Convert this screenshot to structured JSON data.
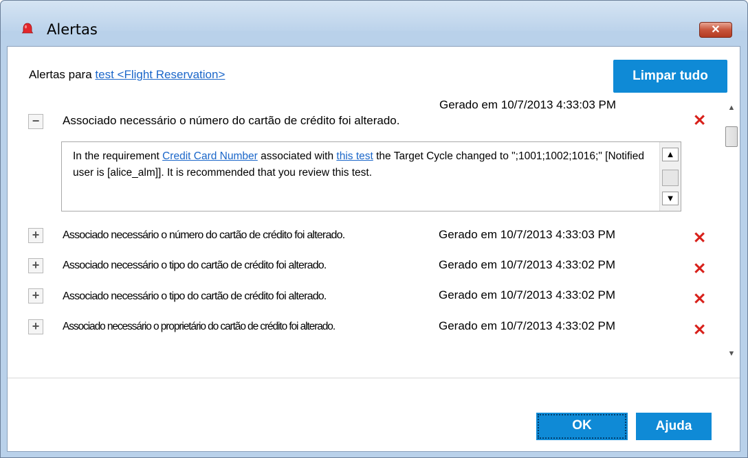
{
  "window": {
    "title": "Alertas",
    "close_label": "✕"
  },
  "header": {
    "prefix": "Alertas para",
    "entity_link": "test <Flight Reservation>",
    "clear_all": "Limpar tudo"
  },
  "alerts": [
    {
      "expanded": true,
      "toggle": "−",
      "title": "Associado necessário o número do cartão de crédito foi alterado.",
      "generated": "Gerado em 10/7/2013 4:33:03 PM",
      "detail": {
        "part1": "In the requirement ",
        "link1": "Credit Card Number",
        "part2": " associated with ",
        "link2": "this test",
        "part3": " the Target Cycle changed to \";1001;1002;1016;\" [Notified user is [alice_alm]]. It is recommended that you review this test."
      }
    },
    {
      "expanded": false,
      "toggle": "+",
      "title": "Associado necessário o número do cartão de crédito foi alterado.",
      "generated": "Gerado em 10/7/2013 4:33:03 PM"
    },
    {
      "expanded": false,
      "toggle": "+",
      "title": "Associado necessário o tipo do cartão de crédito foi alterado.",
      "generated": "Gerado em 10/7/2013 4:33:02 PM"
    },
    {
      "expanded": false,
      "toggle": "+",
      "title": "Associado necessário o tipo do cartão de crédito foi alterado.",
      "generated": "Gerado em 10/7/2013 4:33:02 PM"
    },
    {
      "expanded": false,
      "toggle": "+",
      "title": "Associado necessário o proprietário do cartão de crédito foi alterado.",
      "generated": "Gerado em 10/7/2013 4:33:02 PM"
    }
  ],
  "delete_glyph": "✕",
  "footer": {
    "ok": "OK",
    "help": "Ajuda"
  },
  "colors": {
    "accent": "#0f8ad6",
    "link": "#1a66c9",
    "delete": "#d8201a"
  }
}
